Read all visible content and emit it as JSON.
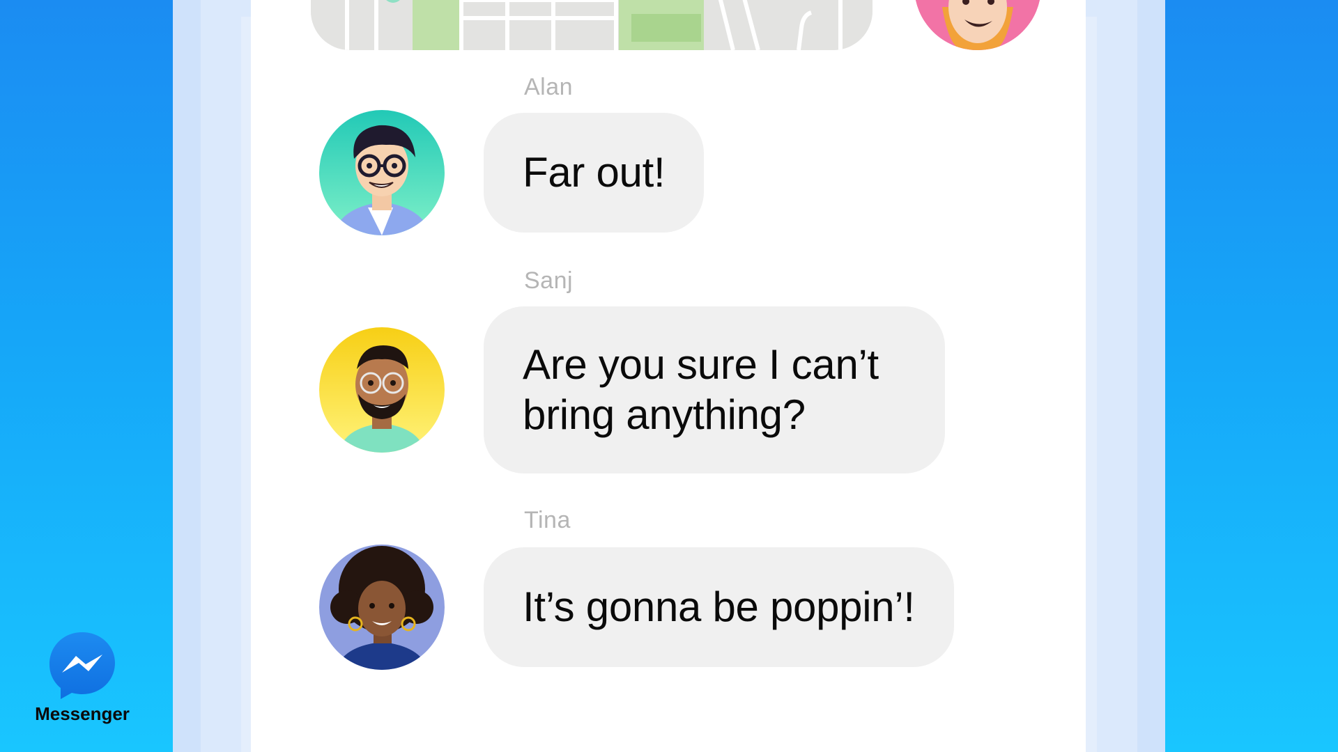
{
  "app": {
    "name": "Messenger",
    "brand_color": "#1b8cf2"
  },
  "conversation": {
    "top_items": [
      {
        "type": "location-map",
        "icon": "map-icon"
      },
      {
        "type": "avatar",
        "icon": "avatar-pink-icon"
      }
    ],
    "messages": [
      {
        "sender": "Alan",
        "text": "Far out!",
        "avatar": "avatar-alan-icon",
        "avatar_color": "#2fd3b0"
      },
      {
        "sender": "Sanj",
        "text": "Are you sure I can’t bring anything?",
        "avatar": "avatar-sanj-icon",
        "avatar_color": "#f7d322"
      },
      {
        "sender": "Tina",
        "text": "It’s gonna be poppin’!",
        "avatar": "avatar-tina-icon",
        "avatar_color": "#8e9ee0"
      }
    ]
  }
}
